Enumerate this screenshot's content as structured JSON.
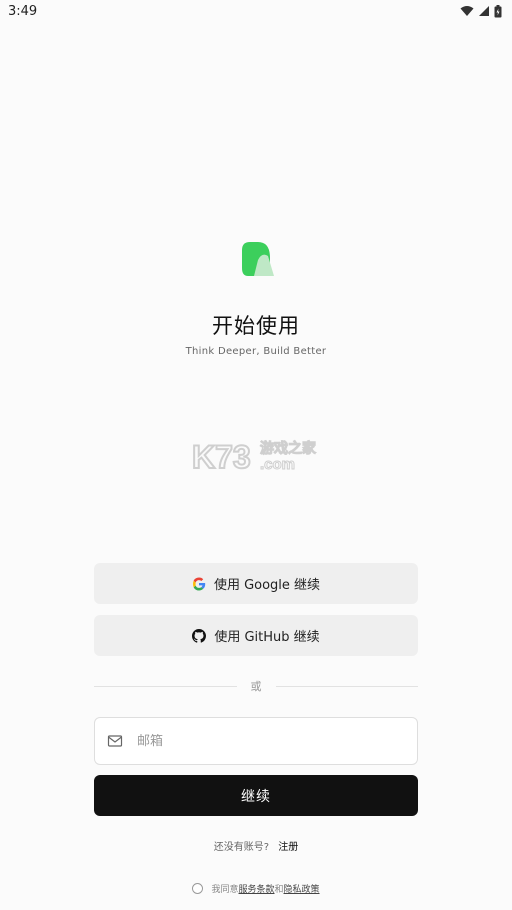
{
  "status_bar": {
    "time": "3:49"
  },
  "header": {
    "title": "开始使用",
    "subtitle": "Think Deeper, Build Better"
  },
  "watermark": {
    "brand": "K73",
    "cn": "游戏之家",
    "domain": ".com"
  },
  "auth": {
    "google_label": "使用 Google 继续",
    "github_label": "使用 GitHub 继续",
    "or_text": "或",
    "email_placeholder": "邮箱",
    "email_value": "",
    "continue_label": "继续"
  },
  "footer": {
    "no_account_text": "还没有账号?",
    "signup_label": "注册",
    "agree_prefix": "我同意",
    "terms_label": "服务条款",
    "and_text": "和",
    "privacy_label": "隐私政策"
  },
  "colors": {
    "logo_green": "#3ccf5c",
    "logo_light": "#bfe8c6",
    "button_dark": "#111111",
    "button_light": "#efefef"
  }
}
